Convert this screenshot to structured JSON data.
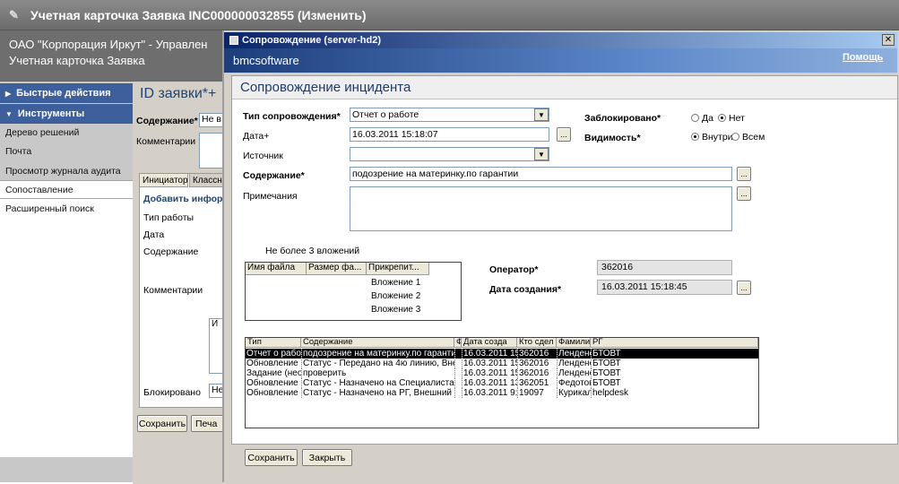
{
  "outer": {
    "title": "Учетная карточка Заявка INC000000032855 (Изменить)"
  },
  "header": {
    "org": "ОАО \"Корпорация Иркут\" - Управлен",
    "card": "Учетная карточка Заявка"
  },
  "nav": {
    "quick": "Быстрые действия",
    "tools": "Инструменты",
    "items": [
      "Дерево решений",
      "Почта",
      "Просмотр журнала аудита",
      "Сопоставление",
      "Расширенный поиск"
    ]
  },
  "mid": {
    "title": "ID заявки*+",
    "content_label": "Содержание*",
    "content_value": "Не в",
    "comments_label": "Комментарии",
    "tab1": "Инициатор",
    "tab2": "Классн",
    "add_info": "Добавить инфор",
    "work_type": "Тип работы",
    "date": "Дата",
    "content": "Содержание",
    "comments": "Комментарии",
    "small_field": "И",
    "blocked_label": "Блокировано",
    "blocked_value": "Не",
    "save": "Сохранить",
    "print": "Печа"
  },
  "dialog": {
    "title": "Сопровождение (server-hd2)",
    "brand": "bmcsoftware",
    "help": "Помощь",
    "heading": "Сопровождение инцидента",
    "type_label": "Тип сопровождения*",
    "type_value": "Отчет о работе",
    "date_label": "Дата+",
    "date_value": "16.03.2011 15:18:07",
    "source_label": "Источник",
    "source_value": "",
    "content_label": "Содержание*",
    "content_value": "подозрение на материнку.по гарантии",
    "notes_label": "Примечания",
    "locked_label": "Заблокировано*",
    "locked_yes": "Да",
    "locked_no": "Нет",
    "visibility_label": "Видимость*",
    "vis_inside": "Внутри",
    "vis_all": "Всем",
    "attach_note": "Не более 3 вложений",
    "attach_headers": [
      "Имя файла",
      "Размер фа...",
      "Прикрепит..."
    ],
    "attachments": [
      "Вложение 1",
      "Вложение 2",
      "Вложение 3"
    ],
    "operator_label": "Оператор*",
    "operator_value": "362016",
    "created_label": "Дата создания*",
    "created_value": "16.03.2011 15:18:45",
    "ellipsis": "...",
    "save": "Сохранить",
    "close": "Закрыть",
    "log_headers": [
      "Тип",
      "Содержание",
      "Ф",
      "Дата созда",
      "Кто сдел",
      "Фамили",
      "РГ"
    ],
    "log_rows": [
      [
        "Отчет о работ",
        "подозрение на материнку.по гарантии",
        "",
        "16.03.2011 15",
        "362016",
        "Лендене",
        "БТОВТ"
      ],
      [
        "Обновление",
        "Статус - Передано на 4ю линию, Внешн",
        "",
        "16.03.2011 15",
        "362016",
        "Лендене",
        "БТОВТ"
      ],
      [
        "Задание (нео",
        "проверить",
        "",
        "16.03.2011 15",
        "362016",
        "Лендене",
        "БТОВТ"
      ],
      [
        "Обновление",
        "Статус - Назначено на Специалиста, В",
        "",
        "16.03.2011 13",
        "362051",
        "Федотов",
        "БТОВТ"
      ],
      [
        "Обновление",
        "Статус - Назначено на РГ, Внешний ст",
        "",
        "16.03.2011 9:",
        "19097",
        "Курикал",
        "helpdesk"
      ]
    ]
  }
}
